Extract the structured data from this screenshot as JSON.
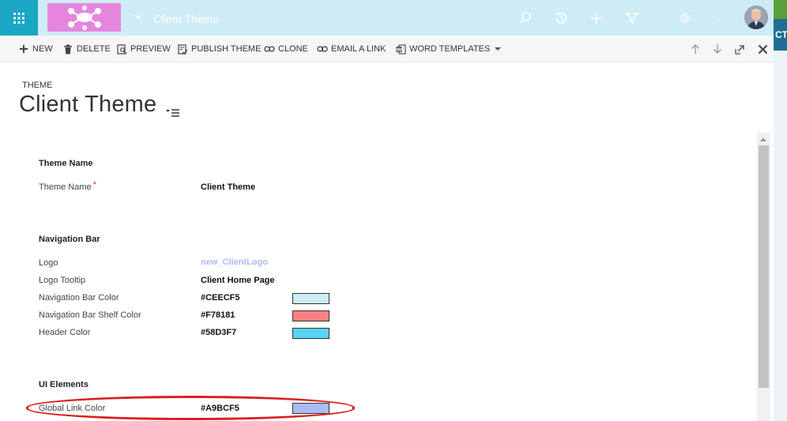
{
  "navbar": {
    "title": "Client Theme",
    "colors": {
      "nav_bar": "#CEECF5",
      "grid_button": "#19A7C4",
      "logo_bg": "#E586DD"
    },
    "icons": [
      "app-grid-icon",
      "logo",
      "chevron-down-icon",
      "search-icon",
      "history-icon",
      "plus-icon",
      "filter-icon",
      "gear-icon",
      "help-icon",
      "avatar"
    ]
  },
  "edge": {
    "text": "CT"
  },
  "commands": [
    {
      "label": "NEW",
      "icon": "plus-icon"
    },
    {
      "label": "DELETE",
      "icon": "trash-icon"
    },
    {
      "label": "PREVIEW",
      "icon": "preview-icon"
    },
    {
      "label": "PUBLISH THEME",
      "icon": "publish-icon"
    },
    {
      "label": "CLONE",
      "icon": "clone-icon"
    },
    {
      "label": "EMAIL A LINK",
      "icon": "link-icon"
    },
    {
      "label": "WORD TEMPLATES",
      "icon": "word-icon"
    }
  ],
  "header": {
    "entity": "THEME",
    "title": "Client Theme"
  },
  "sections": {
    "theme_name": {
      "title": "Theme Name",
      "fields": [
        {
          "label": "Theme Name",
          "value": "Client Theme",
          "required": "*"
        }
      ]
    },
    "navigation_bar": {
      "title": "Navigation Bar",
      "fields": [
        {
          "label": "Logo",
          "value": "new_ClientLogo"
        },
        {
          "label": "Logo Tooltip",
          "value": "Client Home Page"
        },
        {
          "label": "Navigation Bar Color",
          "value": "#CEECF5",
          "color": "#CEECF5"
        },
        {
          "label": "Navigation Bar Shelf Color",
          "value": "#F78181",
          "color": "#F78181"
        },
        {
          "label": "Header Color",
          "value": "#58D3F7",
          "color": "#58D3F7"
        }
      ]
    },
    "ui_elements": {
      "title": "UI Elements",
      "fields": [
        {
          "label": "Global Link Color",
          "value": "#A9BCF5",
          "color": "#A9BCF5"
        }
      ]
    }
  }
}
